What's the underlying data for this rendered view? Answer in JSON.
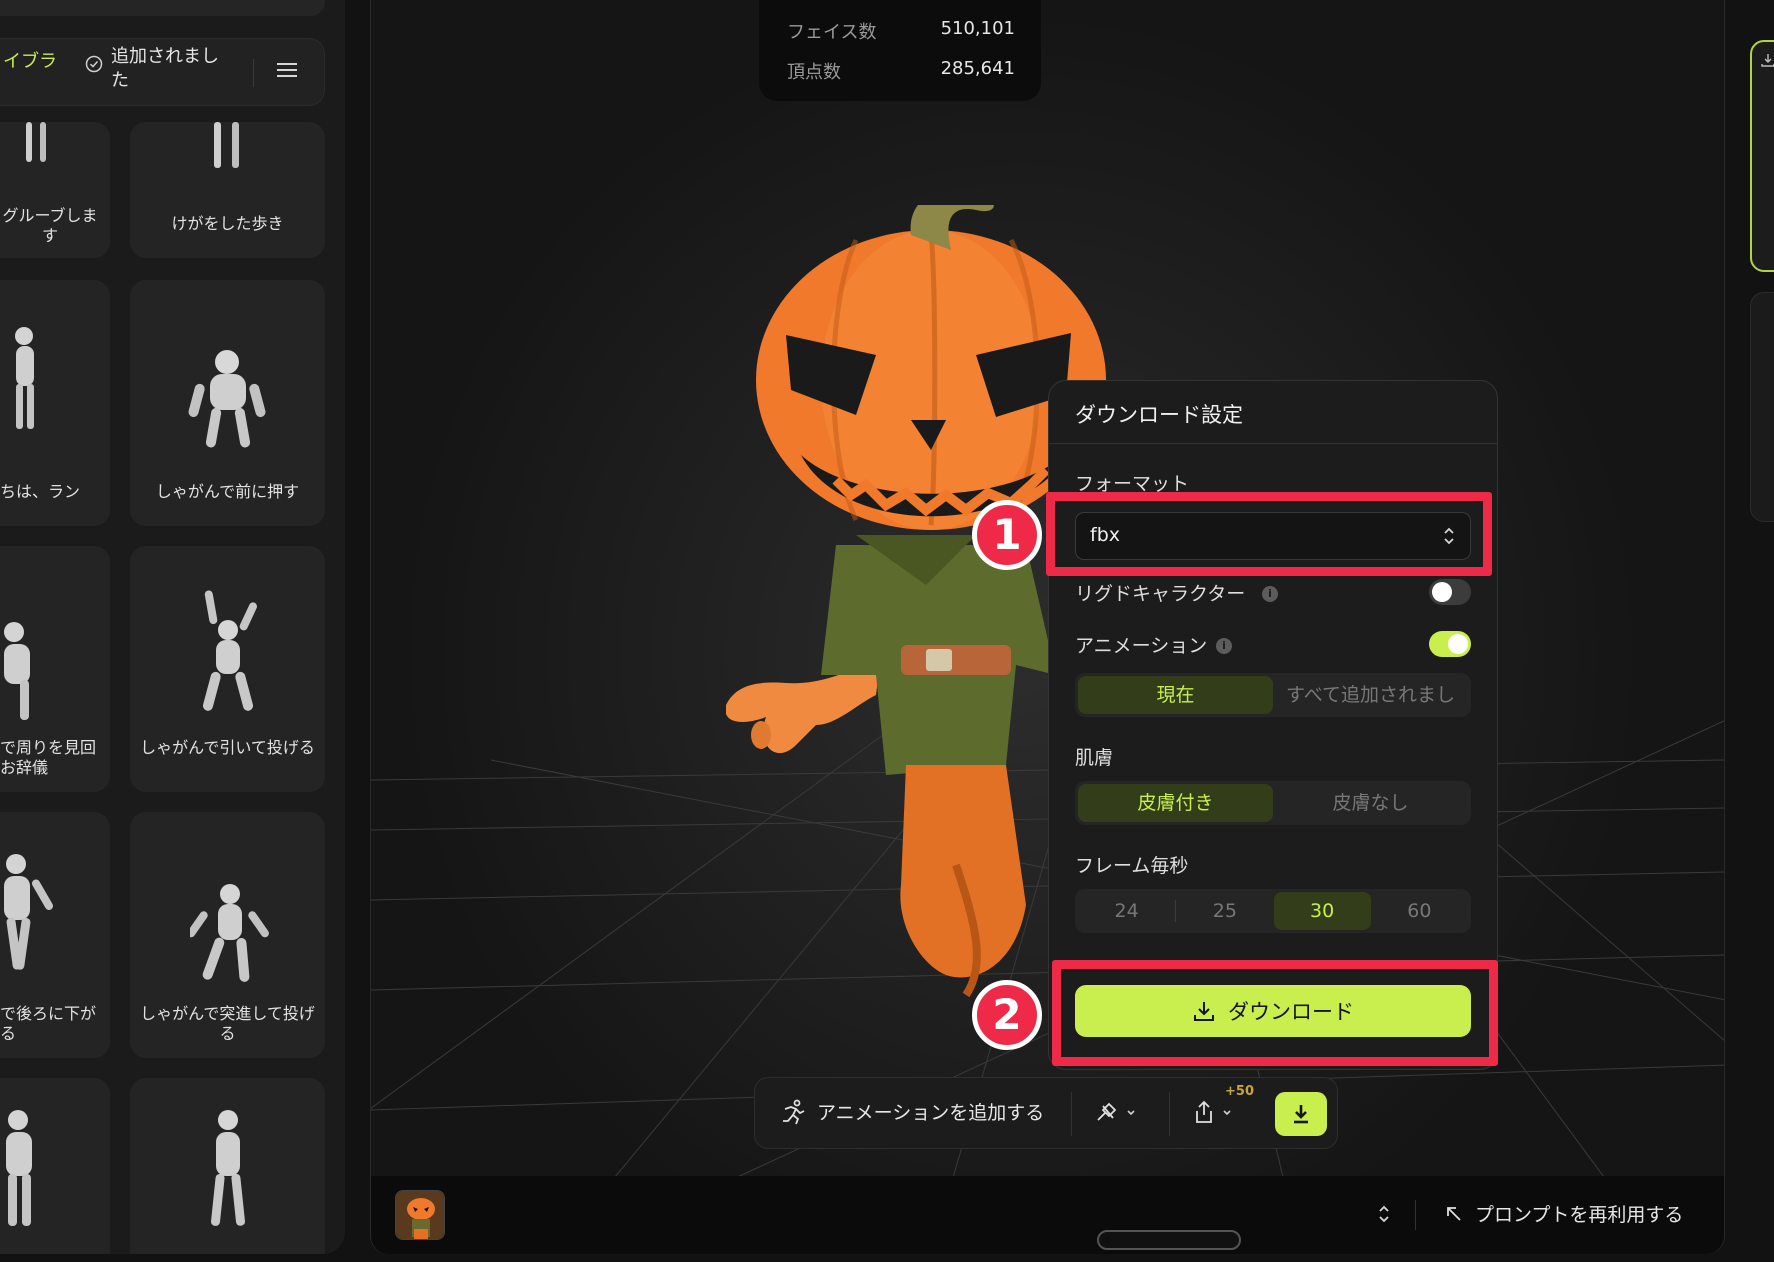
{
  "library": {
    "tab_label": "イブラ",
    "added_filter_label": "追加されました",
    "cards": [
      {
        "label": "グルーブします"
      },
      {
        "label": "けがをした歩き"
      },
      {
        "label": "ちは、ラン"
      },
      {
        "label": "しゃがんで前に押す"
      },
      {
        "label": "で周りを見回お辞儀"
      },
      {
        "label": "しゃがんで引いて投げる"
      },
      {
        "label": "で後ろに下がる"
      },
      {
        "label": "しゃがんで突進して投げる"
      },
      {
        "label": ""
      },
      {
        "label": ""
      }
    ]
  },
  "stats": {
    "faces_label": "フェイス数",
    "faces_value": "510,101",
    "vertices_label": "頂点数",
    "vertices_value": "285,641"
  },
  "download_settings": {
    "title": "ダウンロード設定",
    "format_label": "フォーマット",
    "format_value": "fbx",
    "rigged_label": "リグドキャラクター",
    "rigged_enabled": false,
    "animation_label": "アニメーション",
    "animation_enabled": true,
    "animation_options": [
      "現在",
      "すべて追加されまし"
    ],
    "animation_selected": "現在",
    "skin_label": "肌膚",
    "skin_options": [
      "皮膚付き",
      "皮膚なし"
    ],
    "skin_selected": "皮膚付き",
    "fps_label": "フレーム毎秒",
    "fps_options": [
      "24",
      "25",
      "30",
      "60"
    ],
    "fps_selected": "30",
    "download_button_label": "ダウンロード"
  },
  "annotations": {
    "step1": "1",
    "step2": "2",
    "highlight_color": "#ee2a48"
  },
  "action_bar": {
    "add_animation_label": "アニメーションを追加する",
    "credit_badge": "+50"
  },
  "bottom_bar": {
    "reuse_prompt_label": "プロンプトを再利用する"
  },
  "colors": {
    "accent": "#c8ef4d",
    "panel": "#1c1c1c",
    "background": "#121212"
  },
  "icons": [
    "check-circle-icon",
    "menu-icon",
    "info-icon",
    "chevron-updown-icon",
    "download-icon",
    "running-icon",
    "rig-icon",
    "share-icon",
    "arrow-up-left-icon"
  ]
}
